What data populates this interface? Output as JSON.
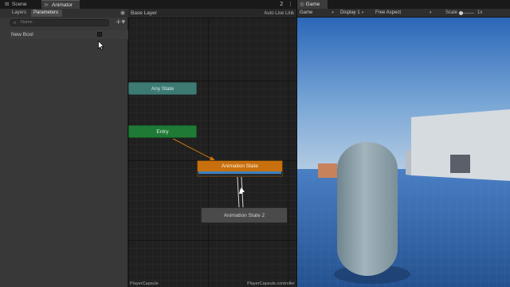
{
  "left_tabs": {
    "scene": "Scene",
    "animator": "Animator"
  },
  "params_panel": {
    "subtab_layers": "Layers",
    "subtab_parameters": "Parameters",
    "search_placeholder": "Name",
    "parameters": [
      {
        "name": "New Bool",
        "checked": false
      }
    ]
  },
  "graph": {
    "breadcrumb": "Base Layer",
    "auto_live_link": "Auto Live Link",
    "nodes": {
      "any_state": "Any State",
      "entry": "Entry",
      "animation_state": "Animation State",
      "animation_state_2": "Animation State 2"
    },
    "footer_left": "PlayerCapsule",
    "footer_right": "PlayerCapsule.controller"
  },
  "game_view": {
    "tab": "Game",
    "mode": "Game",
    "display": "Display 1",
    "aspect": "Free Aspect",
    "scale_label": "Scale",
    "scale_value": "1x"
  },
  "colors": {
    "any_state": "#3d7a74",
    "entry": "#1f7a36",
    "active_state": "#c8700e",
    "sky_top": "#2b67b8",
    "floor": "#2f5d9a",
    "capsule": "#8fa3ac"
  }
}
